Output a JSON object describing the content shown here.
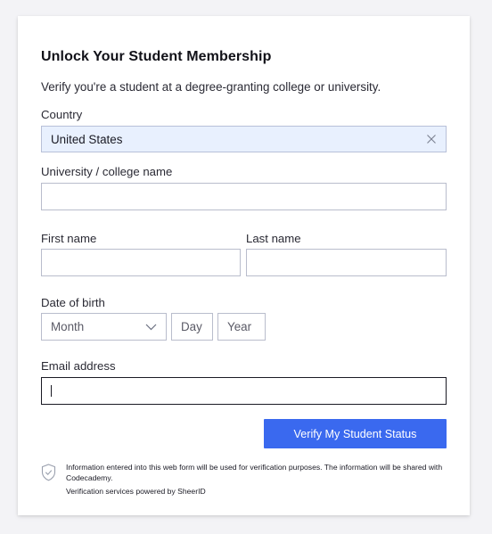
{
  "form": {
    "title": "Unlock Your Student Membership",
    "subtitle": "Verify you're a student at a degree-granting college or university.",
    "country": {
      "label": "Country",
      "value": "United States",
      "clear_icon": "close-icon"
    },
    "university": {
      "label": "University / college name",
      "value": ""
    },
    "first_name": {
      "label": "First name",
      "value": ""
    },
    "last_name": {
      "label": "Last name",
      "value": ""
    },
    "dob": {
      "label": "Date of birth",
      "month_placeholder": "Month",
      "day_placeholder": "Day",
      "year_placeholder": "Year",
      "month_icon": "chevron-down-icon"
    },
    "email": {
      "label": "Email address",
      "value": ""
    },
    "submit_label": "Verify My Student Status",
    "notice": "Information entered into this web form will be used for verification purposes. The information will be shared with Codecademy.",
    "powered_by": "Verification services powered by SheerID",
    "notice_icon": "shield-check-icon"
  },
  "colors": {
    "accent": "#3a69ef",
    "country_bg": "#e8f0fe",
    "border": "#b9bdcc",
    "page_bg": "#f3f3f6"
  }
}
